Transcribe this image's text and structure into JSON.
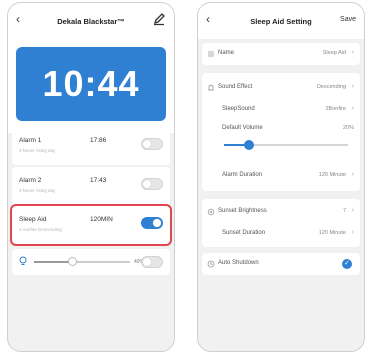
{
  "left_screen": {
    "header": {
      "back_glyph": "‹",
      "title": "Dekala Blackstar™",
      "edit_icon": "pencil-icon"
    },
    "clock": {
      "time": "10:44",
      "bg_color": "#2f7fd3"
    },
    "alarms": [
      {
        "name": "Alarm 1",
        "sub": "3 Never rising day",
        "time": "17:86",
        "enabled": false
      },
      {
        "name": "Alarm 2",
        "sub": "3 Never rising day",
        "time": "17:43",
        "enabled": false
      }
    ],
    "sleep_aid": {
      "name": "Sleep Aid",
      "sub": "3 Aonfire Descending",
      "duration": "120MIN",
      "enabled": true,
      "highlight_color": "#e04650"
    },
    "volume": {
      "icon": "bulb-icon",
      "percent_label": "40%",
      "level": 0.4,
      "enabled": false
    }
  },
  "right_screen": {
    "header": {
      "back_glyph": "‹",
      "title": "Sleep Aid Setting",
      "save_label": "Save"
    },
    "name_row": {
      "icon": "list-icon",
      "label": "Name",
      "value": "Sleep Aid",
      "chevron": "›"
    },
    "sound_section": {
      "sound_effect": {
        "icon": "bell-icon",
        "label": "Sound Effect",
        "value": "Descending",
        "chevron": "›"
      },
      "sleep_sound": {
        "label": "SleepSound",
        "value": "2Bonfire",
        "chevron": "›"
      },
      "default_volume": {
        "label": "Default Volume",
        "value": "20%",
        "level": 0.2
      },
      "alarm_duration": {
        "label": "Alarm Duration",
        "value": "120 Minute",
        "chevron": "›"
      }
    },
    "sunset_section": {
      "sunset_brightness": {
        "icon": "sun-icon",
        "label": "Sunset Brightness",
        "value": "7",
        "chevron": "›"
      },
      "sunset_duration": {
        "label": "Sunset Duration",
        "value": "120 Minute",
        "chevron": "›"
      }
    },
    "auto_shutdown": {
      "icon": "clock-icon",
      "label": "Auto Shutdown",
      "checked": true,
      "check_glyph": "✓"
    },
    "accent_color": "#2f7fd3"
  }
}
